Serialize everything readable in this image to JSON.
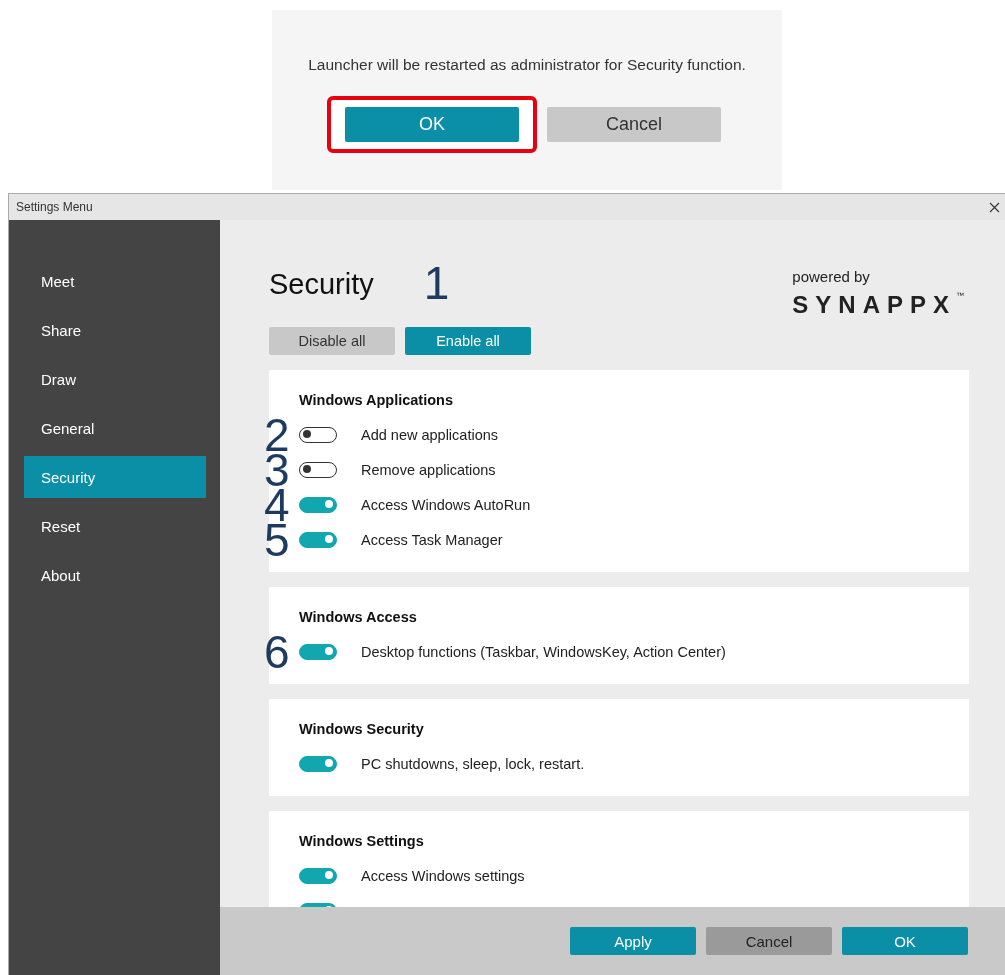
{
  "dialog": {
    "message": "Launcher will be restarted as administrator for Security function.",
    "buttons": [
      {
        "label": "OK",
        "kind": "primary",
        "highlighted": true
      },
      {
        "label": "Cancel",
        "kind": "secondary",
        "highlighted": false
      }
    ]
  },
  "window": {
    "title": "Settings Menu"
  },
  "sidebar": {
    "items": [
      {
        "label": "Meet",
        "selected": false
      },
      {
        "label": "Share",
        "selected": false
      },
      {
        "label": "Draw",
        "selected": false
      },
      {
        "label": "General",
        "selected": false
      },
      {
        "label": "Security",
        "selected": true
      },
      {
        "label": "Reset",
        "selected": false
      },
      {
        "label": "About",
        "selected": false
      }
    ]
  },
  "page": {
    "title": "Security",
    "marker": "1",
    "powered_by": "powered by",
    "logo": "SYNAPPX",
    "trademark": "™",
    "buttons": [
      {
        "label": "Disable all",
        "kind": "secondary"
      },
      {
        "label": "Enable all",
        "kind": "primary"
      }
    ]
  },
  "sections": [
    {
      "title": "Windows Applications",
      "items": [
        {
          "label": "Add new applications",
          "on": false,
          "marker": "2"
        },
        {
          "label": "Remove applications",
          "on": false,
          "marker": "3"
        },
        {
          "label": "Access Windows AutoRun",
          "on": true,
          "marker": "4"
        },
        {
          "label": "Access Task Manager",
          "on": true,
          "marker": "5"
        }
      ]
    },
    {
      "title": "Windows Access",
      "items": [
        {
          "label": "Desktop functions (Taskbar, WindowsKey, Action Center)",
          "on": true,
          "marker": "6"
        }
      ]
    },
    {
      "title": "Windows Security",
      "items": [
        {
          "label": "PC shutdowns, sleep, lock, restart.",
          "on": true
        }
      ]
    },
    {
      "title": "Windows Settings",
      "items": [
        {
          "label": "Access Windows settings",
          "on": true
        },
        {
          "on": true
        }
      ]
    }
  ],
  "footer": {
    "buttons": [
      {
        "label": "Apply",
        "kind": "primary"
      },
      {
        "label": "Cancel",
        "kind": "neutral"
      },
      {
        "label": "OK",
        "kind": "primary"
      }
    ]
  }
}
